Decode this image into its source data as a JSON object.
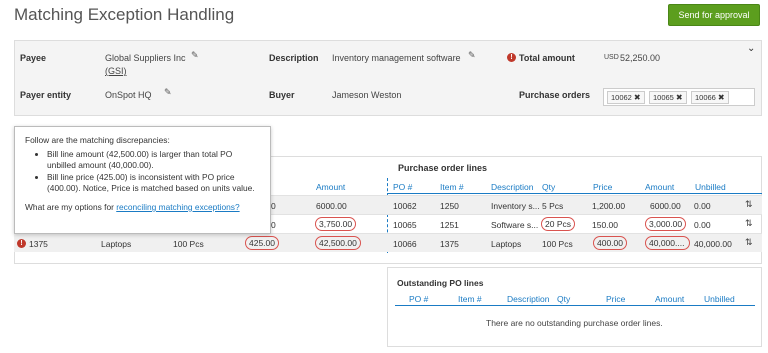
{
  "page": {
    "title": "Matching Exception Handling",
    "send_button": "Send for approval"
  },
  "header": {
    "payee_label": "Payee",
    "payee_value": "Global Suppliers Inc",
    "payee_code": "(GSI)",
    "description_label": "Description",
    "description_value": "Inventory management software",
    "total_label": "Total amount",
    "total_currency": "USD",
    "total_value": "52,250.00",
    "payer_label": "Payer entity",
    "payer_value": "OnSpot HQ",
    "buyer_label": "Buyer",
    "buyer_value": "Jameson Weston",
    "po_label": "Purchase orders",
    "po_chips": [
      "10062",
      "10065",
      "10066"
    ]
  },
  "tooltip": {
    "intro": "Follow are the matching discrepancies:",
    "bullets": [
      "Bill line amount (42,500.00) is larger than total PO unbilled amount (40,000.00).",
      "Bill line price (425.00) is inconsistent with PO price (400.00). Notice, Price is matched based on units value."
    ],
    "question": "What are my options for ",
    "link": "reconciling matching exceptions?"
  },
  "lines": {
    "section_title": "Purchase order lines",
    "bill_headers": {
      "amount": "Amount"
    },
    "po_headers": {
      "po": "PO #",
      "item": "Item #",
      "description": "Description",
      "qty": "Qty",
      "price": "Price",
      "amount": "Amount",
      "unbilled": "Unbilled"
    },
    "rows": [
      {
        "bill_frag": "0",
        "bill_amount": "6000.00",
        "po": "10062",
        "item": "1250",
        "description": "Inventory s...",
        "qty": "5 Pcs",
        "price": "1,200.00",
        "amount": "6000.00",
        "unbilled": "0.00"
      },
      {
        "bill_frag": "0",
        "bill_amount": "3,750.00",
        "po": "10065",
        "item": "1251",
        "description": "Software s...",
        "qty": "20 Pcs",
        "price": "150.00",
        "amount": "3,000.00",
        "unbilled": "0.00"
      },
      {
        "bill_line": "1375",
        "bill_desc": "Laptops",
        "bill_qty": "100 Pcs",
        "bill_price": "425.00",
        "bill_amount": "42,500.00",
        "po": "10066",
        "item": "1375",
        "description": "Laptops",
        "qty": "100 Pcs",
        "price": "400.00",
        "amount": "40,000....",
        "unbilled": "40,000.00"
      }
    ]
  },
  "outstanding": {
    "title": "Outstanding PO lines",
    "headers": {
      "po": "PO #",
      "item": "Item #",
      "description": "Description",
      "qty": "Qty",
      "price": "Price",
      "amount": "Amount",
      "unbilled": "Unbilled"
    },
    "empty": "There are no outstanding purchase order lines."
  },
  "colors": {
    "accent": "#1a7bc4",
    "primary_button": "#5c9e1e",
    "error": "#d9534f"
  }
}
